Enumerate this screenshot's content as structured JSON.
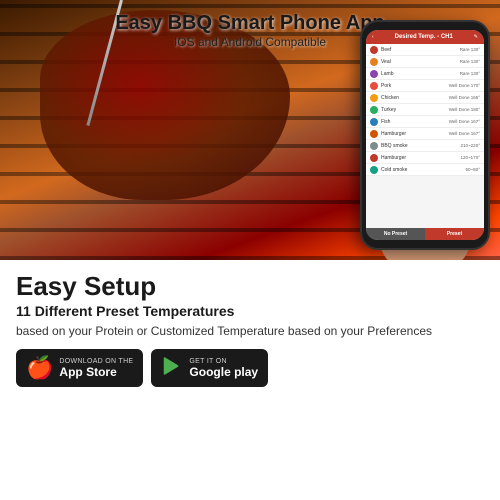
{
  "hero": {
    "title": "Easy BBQ Smart Phone App",
    "subtitle": "IOS and Android Compatible"
  },
  "phone": {
    "header": "Desired Temp. - CH1",
    "items": [
      {
        "name": "Beef",
        "temp": "Rare 130°",
        "color": "#c0392b"
      },
      {
        "name": "Veal",
        "temp": "Rare 130°",
        "color": "#e67e22"
      },
      {
        "name": "Lamb",
        "temp": "Rare 130°",
        "color": "#8e44ad"
      },
      {
        "name": "Pork",
        "temp": "Well Done 170°",
        "color": "#e74c3c"
      },
      {
        "name": "Chicken",
        "temp": "Well Done 165°",
        "color": "#f39c12"
      },
      {
        "name": "Turkey",
        "temp": "Well Done 180°",
        "color": "#27ae60"
      },
      {
        "name": "Fish",
        "temp": "Well Done 167°",
        "color": "#2980b9"
      },
      {
        "name": "Hamburger",
        "temp": "Well Done 167°",
        "color": "#d35400"
      },
      {
        "name": "BBQ smoke",
        "temp": "210~220°",
        "color": "#7f8c8d"
      },
      {
        "name": "Hamburger",
        "temp": "120~170°",
        "color": "#c0392b"
      },
      {
        "name": "Cold smoke",
        "temp": "50~80°",
        "color": "#16a085"
      }
    ],
    "footer": {
      "no_preset": "No Preset",
      "preset": "Preset"
    }
  },
  "setup": {
    "title": "Easy Setup",
    "subtitle": "11 Different Preset Temperatures",
    "description": "based on your Protein or Customized Temperature based on your Preferences"
  },
  "app_store": {
    "pre_label": "Download on the",
    "label": "App Store",
    "icon": "🍎"
  },
  "google_play": {
    "pre_label": "GET IT ON",
    "label": "Google play",
    "icon": "▶"
  }
}
